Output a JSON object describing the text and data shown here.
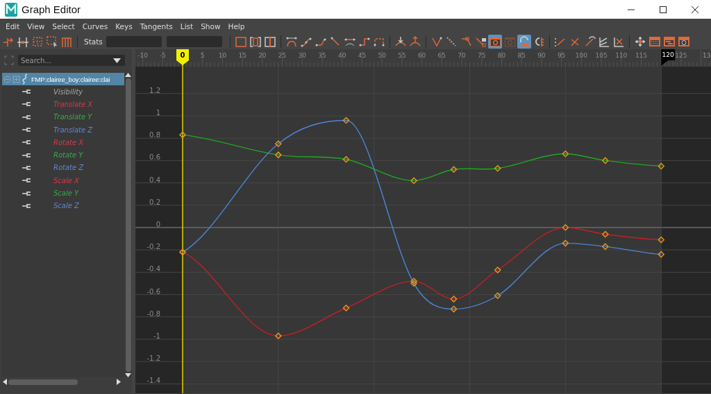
{
  "window": {
    "title": "Graph Editor"
  },
  "menu": [
    "Edit",
    "View",
    "Select",
    "Curves",
    "Keys",
    "Tangents",
    "List",
    "Show",
    "Help"
  ],
  "toolbar": {
    "lead": [
      {
        "kind": "key-move",
        "selected": false,
        "disabled": false
      },
      {
        "kind": "key-insert",
        "selected": false,
        "disabled": false
      },
      {
        "kind": "lattice",
        "selected": false,
        "disabled": false
      },
      {
        "kind": "region",
        "selected": false,
        "disabled": false
      },
      {
        "kind": "retime",
        "selected": false,
        "disabled": false
      }
    ],
    "stats_label": "Stats",
    "groups": [
      [
        {
          "kind": "frame-all",
          "selected": false,
          "disabled": false
        },
        {
          "kind": "frame-range",
          "selected": false,
          "disabled": false
        },
        {
          "kind": "center",
          "selected": false,
          "disabled": false
        }
      ],
      [
        {
          "kind": "auto",
          "selected": false,
          "disabled": false
        },
        {
          "kind": "spline",
          "selected": false,
          "disabled": false
        },
        {
          "kind": "clamped",
          "selected": false,
          "disabled": false
        },
        {
          "kind": "linear",
          "selected": false,
          "disabled": false
        },
        {
          "kind": "flat",
          "selected": false,
          "disabled": false
        },
        {
          "kind": "step",
          "selected": false,
          "disabled": false
        },
        {
          "kind": "plateau",
          "selected": false,
          "disabled": false
        }
      ],
      [
        {
          "kind": "buffer-down",
          "selected": false,
          "disabled": false
        },
        {
          "kind": "buffer-up",
          "selected": false,
          "disabled": false
        }
      ],
      [
        {
          "kind": "break",
          "selected": false,
          "disabled": false
        },
        {
          "kind": "unify",
          "selected": false,
          "disabled": false
        },
        {
          "kind": "weight",
          "selected": false,
          "disabled": false
        },
        {
          "kind": "lock",
          "selected": false,
          "disabled": false
        },
        {
          "kind": "window",
          "selected": true,
          "disabled": false
        },
        {
          "kind": "window",
          "selected": false,
          "disabled": true
        },
        {
          "kind": "magnet",
          "selected": true,
          "disabled": false
        },
        {
          "kind": "snap",
          "selected": false,
          "disabled": false
        }
      ],
      [
        {
          "kind": "pre-infinity",
          "selected": false,
          "disabled": false
        },
        {
          "kind": "cross",
          "selected": false,
          "disabled": false
        },
        {
          "kind": "cycle",
          "selected": false,
          "disabled": false
        },
        {
          "kind": "stack",
          "selected": false,
          "disabled": false
        },
        {
          "kind": "normalize",
          "selected": false,
          "disabled": false
        }
      ],
      [
        {
          "kind": "move",
          "selected": false,
          "disabled": false
        },
        {
          "kind": "panel-grid",
          "selected": false,
          "disabled": false
        },
        {
          "kind": "panel-bars",
          "selected": false,
          "disabled": false
        },
        {
          "kind": "panel-clock",
          "selected": false,
          "disabled": false
        }
      ]
    ]
  },
  "outliner": {
    "search": {
      "placeholder": "Search..."
    },
    "root": {
      "label": "FMP:clairee_boy:clairee:clai",
      "selected": true,
      "expanded": true,
      "children": [
        {
          "label": "Visibility",
          "color": "#a8a8a8"
        },
        {
          "label": "Translate X",
          "color": "#d23a4c"
        },
        {
          "label": "Translate Y",
          "color": "#3aa84a"
        },
        {
          "label": "Translate Z",
          "color": "#5f86d0"
        },
        {
          "label": "Rotate X",
          "color": "#d23a4c"
        },
        {
          "label": "Rotate Y",
          "color": "#3aa84a"
        },
        {
          "label": "Rotate Z",
          "color": "#5f86d0"
        },
        {
          "label": "Scale X",
          "color": "#d23a4c"
        },
        {
          "label": "Scale Y",
          "color": "#3aa84a"
        },
        {
          "label": "Scale Z",
          "color": "#5f86d0"
        }
      ]
    }
  },
  "graph": {
    "current_time": "0",
    "range_end": "120",
    "ruler_edge_label": "13",
    "chart_data": {
      "type": "line",
      "x": [
        0,
        24,
        41,
        58,
        68,
        79,
        96,
        106,
        120
      ],
      "series": [
        {
          "color": "#1fa81f",
          "marker": "diamond",
          "values": [
            0.83,
            0.65,
            0.61,
            0.42,
            0.52,
            0.53,
            0.66,
            0.6,
            0.55
          ]
        },
        {
          "color": "#4a86d8",
          "marker": "diamond",
          "values": [
            -0.22,
            0.75,
            0.96,
            -0.5,
            -0.73,
            -0.61,
            -0.14,
            -0.17,
            -0.24
          ]
        },
        {
          "color": "#c61e28",
          "marker": "diamond",
          "values": [
            -0.22,
            -0.97,
            -0.72,
            -0.48,
            -0.64,
            -0.38,
            0.0,
            -0.06,
            -0.11
          ]
        }
      ],
      "grid": true,
      "ref_lines": [
        {
          "axis": "x",
          "value": 0,
          "color": "#e0d000"
        }
      ],
      "xlim": [
        -11.84,
        132.5
      ],
      "ylim": [
        -1.484,
        1.441
      ],
      "xticks": [
        -10,
        -5,
        5,
        10,
        15,
        20,
        25,
        30,
        35,
        40,
        45,
        50,
        55,
        60,
        65,
        70,
        75,
        80,
        85,
        90,
        95,
        100,
        105,
        110,
        115,
        125
      ],
      "yticks": [
        1.2,
        1,
        0.8,
        0.6,
        0.4,
        0.2,
        0,
        -0.2,
        -0.4,
        -0.6,
        -0.8,
        -1,
        -1.2,
        -1.4
      ]
    }
  }
}
